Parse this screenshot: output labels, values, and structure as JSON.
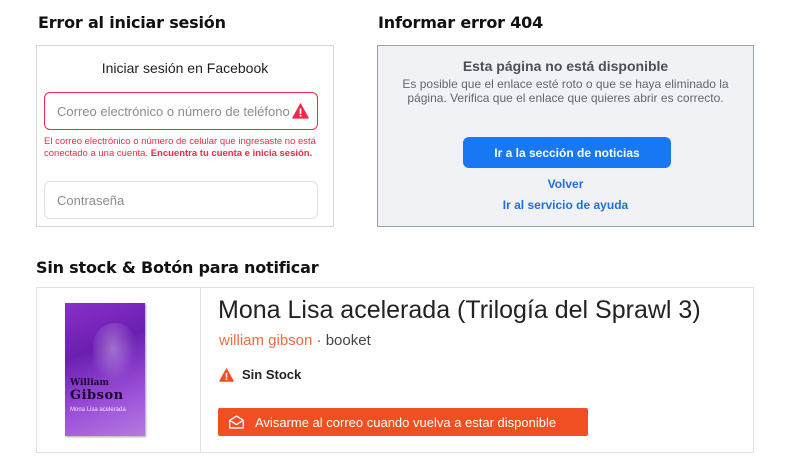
{
  "sections": {
    "login_error_title": "Error al iniciar sesión",
    "error404_title": "Informar error 404",
    "out_of_stock_title": "Sin stock & Botón para notificar"
  },
  "login": {
    "header": "Iniciar sesión en Facebook",
    "email_placeholder": "Correo electrónico o número de teléfono",
    "error_text": "El correo electrónico o número de celular que ingresaste no está conectado a una cuenta.",
    "error_link": "Encuentra tu cuenta e inicia sesión.",
    "password_placeholder": "Contraseña"
  },
  "error404": {
    "heading": "Esta página no está disponible",
    "description": "Es posible que el enlace esté roto o que se haya eliminado la página. Verifica que el enlace que quieres abrir es correcto.",
    "primary_button": "Ir a la sección de noticias",
    "back_link": "Volver",
    "help_link": "Ir al servicio de ayuda"
  },
  "book": {
    "title": "Mona Lisa acelerada (Trilogía del Sprawl 3)",
    "author": "william gibson",
    "separator": " · ",
    "publisher": "booket",
    "stock_status": "Sin Stock",
    "notify_button": "Avisarme al correo cuando vuelva a estar disponible",
    "cover_author_first": "William",
    "cover_author_last": "Gibson",
    "cover_title": "Mona Lisa acelerada"
  },
  "colors": {
    "facebook_blue": "#1877f2",
    "error_red": "#f02849",
    "notify_orange": "#f04e23",
    "author_orange": "#f26a3f"
  },
  "icons": [
    "warning-icon",
    "mail-icon"
  ]
}
